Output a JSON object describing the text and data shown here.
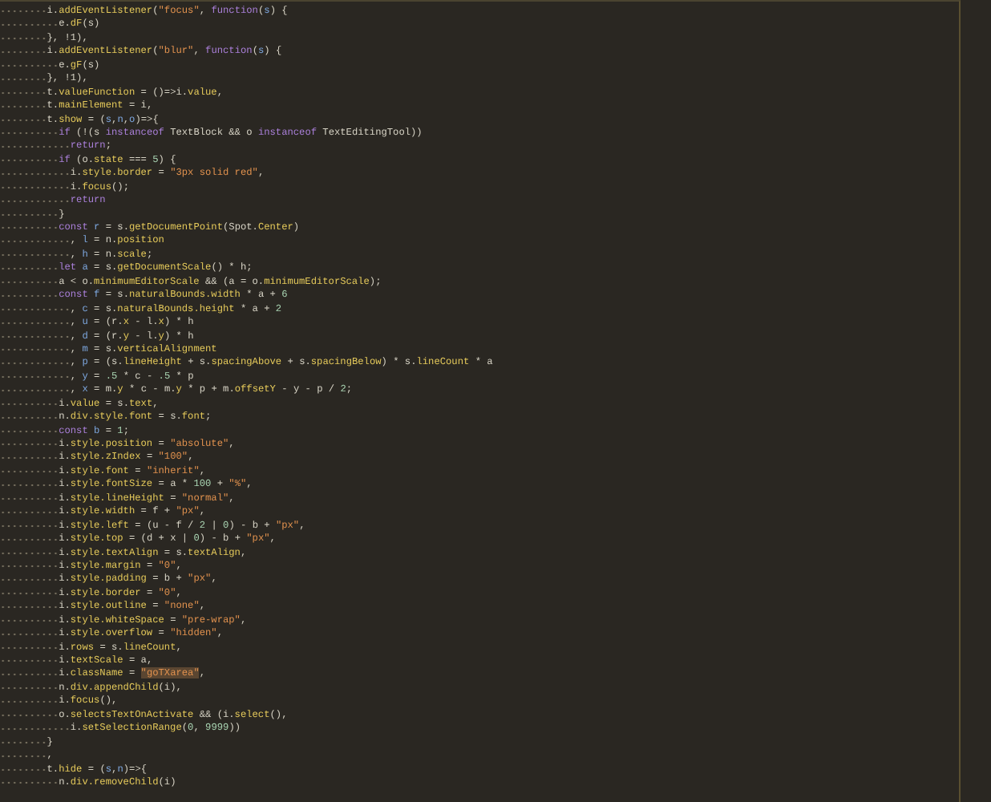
{
  "editor": {
    "lines": [
      {
        "tokens": [
          {
            "kind": "p",
            "text": "i."
          },
          {
            "kind": "y",
            "text": "addEventListener"
          },
          {
            "kind": "p",
            "text": "("
          },
          {
            "kind": "s",
            "text": "\"focus\""
          },
          {
            "kind": "p",
            "text": ", "
          },
          {
            "kind": "k",
            "text": "function"
          },
          {
            "kind": "p",
            "text": "("
          },
          {
            "kind": "v",
            "text": "s"
          },
          {
            "kind": "p",
            "text": ") {"
          }
        ],
        "children": [
          {
            "tokens": [
              {
                "kind": "p",
                "text": "e."
              },
              {
                "kind": "y",
                "text": "dF"
              },
              {
                "kind": "p",
                "text": "(s)"
              }
            ]
          }
        ]
      },
      {
        "tokens": [
          {
            "kind": "p",
            "text": "}, !1),"
          }
        ]
      },
      {
        "tokens": [
          {
            "kind": "p",
            "text": "i."
          },
          {
            "kind": "y",
            "text": "addEventListener"
          },
          {
            "kind": "p",
            "text": "("
          },
          {
            "kind": "s",
            "text": "\"blur\""
          },
          {
            "kind": "p",
            "text": ", "
          },
          {
            "kind": "k",
            "text": "function"
          },
          {
            "kind": "p",
            "text": "("
          },
          {
            "kind": "v",
            "text": "s"
          },
          {
            "kind": "p",
            "text": ") {"
          }
        ],
        "children": [
          {
            "tokens": [
              {
                "kind": "p",
                "text": "e."
              },
              {
                "kind": "y",
                "text": "gF"
              },
              {
                "kind": "p",
                "text": "(s)"
              }
            ]
          }
        ]
      },
      {
        "tokens": [
          {
            "kind": "p",
            "text": "}, !1),"
          }
        ]
      },
      {
        "tokens": [
          {
            "kind": "p",
            "text": "t."
          },
          {
            "kind": "y",
            "text": "valueFunction"
          },
          {
            "kind": "p",
            "text": " = ()=>i."
          },
          {
            "kind": "y",
            "text": "value"
          },
          {
            "kind": "p",
            "text": ","
          }
        ]
      },
      {
        "tokens": [
          {
            "kind": "p",
            "text": "t."
          },
          {
            "kind": "y",
            "text": "mainElement"
          },
          {
            "kind": "p",
            "text": " = i,"
          }
        ]
      },
      {
        "tokens": [
          {
            "kind": "p",
            "text": "t."
          },
          {
            "kind": "y",
            "text": "show"
          },
          {
            "kind": "p",
            "text": " = ("
          },
          {
            "kind": "v",
            "text": "s"
          },
          {
            "kind": "p",
            "text": ","
          },
          {
            "kind": "v",
            "text": "n"
          },
          {
            "kind": "p",
            "text": ","
          },
          {
            "kind": "v",
            "text": "o"
          },
          {
            "kind": "p",
            "text": ")=>{"
          }
        ],
        "children": [
          {
            "tokens": [
              {
                "kind": "k",
                "text": "if"
              },
              {
                "kind": "p",
                "text": " (!(s "
              },
              {
                "kind": "k",
                "text": "instanceof"
              },
              {
                "kind": "p",
                "text": " TextBlock && o "
              },
              {
                "kind": "k",
                "text": "instanceof"
              },
              {
                "kind": "p",
                "text": " TextEditingTool))"
              }
            ],
            "children": [
              {
                "tokens": [
                  {
                    "kind": "k",
                    "text": "return"
                  },
                  {
                    "kind": "p",
                    "text": ";"
                  }
                ]
              }
            ]
          },
          {
            "tokens": [
              {
                "kind": "k",
                "text": "if"
              },
              {
                "kind": "p",
                "text": " (o."
              },
              {
                "kind": "y",
                "text": "state"
              },
              {
                "kind": "p",
                "text": " === "
              },
              {
                "kind": "n",
                "text": "5"
              },
              {
                "kind": "p",
                "text": ") {"
              }
            ],
            "children": [
              {
                "tokens": [
                  {
                    "kind": "p",
                    "text": "i."
                  },
                  {
                    "kind": "y",
                    "text": "style.border"
                  },
                  {
                    "kind": "p",
                    "text": " = "
                  },
                  {
                    "kind": "s",
                    "text": "\"3px solid red\""
                  },
                  {
                    "kind": "p",
                    "text": ","
                  }
                ]
              },
              {
                "tokens": [
                  {
                    "kind": "p",
                    "text": "i."
                  },
                  {
                    "kind": "y",
                    "text": "focus"
                  },
                  {
                    "kind": "p",
                    "text": "();"
                  }
                ]
              },
              {
                "tokens": [
                  {
                    "kind": "k",
                    "text": "return"
                  }
                ]
              }
            ]
          },
          {
            "tokens": [
              {
                "kind": "p",
                "text": "}"
              }
            ]
          },
          {
            "tokens": [
              {
                "kind": "k",
                "text": "const "
              },
              {
                "kind": "v",
                "text": "r"
              },
              {
                "kind": "p",
                "text": " = s."
              },
              {
                "kind": "y",
                "text": "getDocumentPoint"
              },
              {
                "kind": "p",
                "text": "(Spot."
              },
              {
                "kind": "y",
                "text": "Center"
              },
              {
                "kind": "p",
                "text": ")"
              }
            ],
            "children": [
              {
                "tokens": [
                  {
                    "kind": "p",
                    "text": ", "
                  },
                  {
                    "kind": "v",
                    "text": "l"
                  },
                  {
                    "kind": "p",
                    "text": " = n."
                  },
                  {
                    "kind": "y",
                    "text": "position"
                  }
                ]
              },
              {
                "tokens": [
                  {
                    "kind": "p",
                    "text": ", "
                  },
                  {
                    "kind": "v",
                    "text": "h"
                  },
                  {
                    "kind": "p",
                    "text": " = n."
                  },
                  {
                    "kind": "y",
                    "text": "scale"
                  },
                  {
                    "kind": "p",
                    "text": ";"
                  }
                ]
              }
            ]
          },
          {
            "tokens": [
              {
                "kind": "k",
                "text": "let "
              },
              {
                "kind": "v",
                "text": "a"
              },
              {
                "kind": "p",
                "text": " = s."
              },
              {
                "kind": "y",
                "text": "getDocumentScale"
              },
              {
                "kind": "p",
                "text": "() * h;"
              }
            ]
          },
          {
            "tokens": [
              {
                "kind": "p",
                "text": "a < o."
              },
              {
                "kind": "y",
                "text": "minimumEditorScale"
              },
              {
                "kind": "p",
                "text": " && (a = o."
              },
              {
                "kind": "y",
                "text": "minimumEditorScale"
              },
              {
                "kind": "p",
                "text": ");"
              }
            ]
          },
          {
            "tokens": [
              {
                "kind": "k",
                "text": "const "
              },
              {
                "kind": "v",
                "text": "f"
              },
              {
                "kind": "p",
                "text": " = s."
              },
              {
                "kind": "y",
                "text": "naturalBounds.width"
              },
              {
                "kind": "p",
                "text": " * a + "
              },
              {
                "kind": "n",
                "text": "6"
              }
            ],
            "children": [
              {
                "tokens": [
                  {
                    "kind": "p",
                    "text": ", "
                  },
                  {
                    "kind": "v",
                    "text": "c"
                  },
                  {
                    "kind": "p",
                    "text": " = s."
                  },
                  {
                    "kind": "y",
                    "text": "naturalBounds.height"
                  },
                  {
                    "kind": "p",
                    "text": " * a + "
                  },
                  {
                    "kind": "n",
                    "text": "2"
                  }
                ]
              },
              {
                "tokens": [
                  {
                    "kind": "p",
                    "text": ", "
                  },
                  {
                    "kind": "v",
                    "text": "u"
                  },
                  {
                    "kind": "p",
                    "text": " = (r."
                  },
                  {
                    "kind": "y",
                    "text": "x"
                  },
                  {
                    "kind": "p",
                    "text": " - l."
                  },
                  {
                    "kind": "y",
                    "text": "x"
                  },
                  {
                    "kind": "p",
                    "text": ") * h"
                  }
                ]
              },
              {
                "tokens": [
                  {
                    "kind": "p",
                    "text": ", "
                  },
                  {
                    "kind": "v",
                    "text": "d"
                  },
                  {
                    "kind": "p",
                    "text": " = (r."
                  },
                  {
                    "kind": "y",
                    "text": "y"
                  },
                  {
                    "kind": "p",
                    "text": " - l."
                  },
                  {
                    "kind": "y",
                    "text": "y"
                  },
                  {
                    "kind": "p",
                    "text": ") * h"
                  }
                ]
              },
              {
                "tokens": [
                  {
                    "kind": "p",
                    "text": ", "
                  },
                  {
                    "kind": "v",
                    "text": "m"
                  },
                  {
                    "kind": "p",
                    "text": " = s."
                  },
                  {
                    "kind": "y",
                    "text": "verticalAlignment"
                  }
                ]
              },
              {
                "tokens": [
                  {
                    "kind": "p",
                    "text": ", "
                  },
                  {
                    "kind": "v",
                    "text": "p"
                  },
                  {
                    "kind": "p",
                    "text": " = (s."
                  },
                  {
                    "kind": "y",
                    "text": "lineHeight"
                  },
                  {
                    "kind": "p",
                    "text": " + s."
                  },
                  {
                    "kind": "y",
                    "text": "spacingAbove"
                  },
                  {
                    "kind": "p",
                    "text": " + s."
                  },
                  {
                    "kind": "y",
                    "text": "spacingBelow"
                  },
                  {
                    "kind": "p",
                    "text": ") * s."
                  },
                  {
                    "kind": "y",
                    "text": "lineCount"
                  },
                  {
                    "kind": "p",
                    "text": " * a"
                  }
                ]
              },
              {
                "tokens": [
                  {
                    "kind": "p",
                    "text": ", "
                  },
                  {
                    "kind": "v",
                    "text": "y"
                  },
                  {
                    "kind": "p",
                    "text": " = "
                  },
                  {
                    "kind": "n",
                    "text": ".5"
                  },
                  {
                    "kind": "p",
                    "text": " * c - "
                  },
                  {
                    "kind": "n",
                    "text": ".5"
                  },
                  {
                    "kind": "p",
                    "text": " * p"
                  }
                ]
              },
              {
                "tokens": [
                  {
                    "kind": "p",
                    "text": ", "
                  },
                  {
                    "kind": "v",
                    "text": "x"
                  },
                  {
                    "kind": "p",
                    "text": " = m."
                  },
                  {
                    "kind": "y",
                    "text": "y"
                  },
                  {
                    "kind": "p",
                    "text": " * c - m."
                  },
                  {
                    "kind": "y",
                    "text": "y"
                  },
                  {
                    "kind": "p",
                    "text": " * p + m."
                  },
                  {
                    "kind": "y",
                    "text": "offsetY"
                  },
                  {
                    "kind": "p",
                    "text": " - y - p / "
                  },
                  {
                    "kind": "n",
                    "text": "2"
                  },
                  {
                    "kind": "p",
                    "text": ";"
                  }
                ]
              }
            ]
          },
          {
            "tokens": [
              {
                "kind": "p",
                "text": "i."
              },
              {
                "kind": "y",
                "text": "value"
              },
              {
                "kind": "p",
                "text": " = s."
              },
              {
                "kind": "y",
                "text": "text"
              },
              {
                "kind": "p",
                "text": ","
              }
            ]
          },
          {
            "tokens": [
              {
                "kind": "p",
                "text": "n."
              },
              {
                "kind": "y",
                "text": "div.style.font"
              },
              {
                "kind": "p",
                "text": " = s."
              },
              {
                "kind": "y",
                "text": "font"
              },
              {
                "kind": "p",
                "text": ";"
              }
            ]
          },
          {
            "tokens": [
              {
                "kind": "k",
                "text": "const "
              },
              {
                "kind": "v",
                "text": "b"
              },
              {
                "kind": "p",
                "text": " = "
              },
              {
                "kind": "n",
                "text": "1"
              },
              {
                "kind": "p",
                "text": ";"
              }
            ]
          },
          {
            "tokens": [
              {
                "kind": "p",
                "text": "i."
              },
              {
                "kind": "y",
                "text": "style.position"
              },
              {
                "kind": "p",
                "text": " = "
              },
              {
                "kind": "s",
                "text": "\"absolute\""
              },
              {
                "kind": "p",
                "text": ","
              }
            ]
          },
          {
            "tokens": [
              {
                "kind": "p",
                "text": "i."
              },
              {
                "kind": "y",
                "text": "style.zIndex"
              },
              {
                "kind": "p",
                "text": " = "
              },
              {
                "kind": "s",
                "text": "\"100\""
              },
              {
                "kind": "p",
                "text": ","
              }
            ]
          },
          {
            "tokens": [
              {
                "kind": "p",
                "text": "i."
              },
              {
                "kind": "y",
                "text": "style.font"
              },
              {
                "kind": "p",
                "text": " = "
              },
              {
                "kind": "s",
                "text": "\"inherit\""
              },
              {
                "kind": "p",
                "text": ","
              }
            ]
          },
          {
            "tokens": [
              {
                "kind": "p",
                "text": "i."
              },
              {
                "kind": "y",
                "text": "style.fontSize"
              },
              {
                "kind": "p",
                "text": " = a * "
              },
              {
                "kind": "n",
                "text": "100"
              },
              {
                "kind": "p",
                "text": " + "
              },
              {
                "kind": "s",
                "text": "\"%\""
              },
              {
                "kind": "p",
                "text": ","
              }
            ]
          },
          {
            "tokens": [
              {
                "kind": "p",
                "text": "i."
              },
              {
                "kind": "y",
                "text": "style.lineHeight"
              },
              {
                "kind": "p",
                "text": " = "
              },
              {
                "kind": "s",
                "text": "\"normal\""
              },
              {
                "kind": "p",
                "text": ","
              }
            ]
          },
          {
            "tokens": [
              {
                "kind": "p",
                "text": "i."
              },
              {
                "kind": "y",
                "text": "style.width"
              },
              {
                "kind": "p",
                "text": " = f + "
              },
              {
                "kind": "s",
                "text": "\"px\""
              },
              {
                "kind": "p",
                "text": ","
              }
            ]
          },
          {
            "tokens": [
              {
                "kind": "p",
                "text": "i."
              },
              {
                "kind": "y",
                "text": "style.left"
              },
              {
                "kind": "p",
                "text": " = (u - f / "
              },
              {
                "kind": "n",
                "text": "2"
              },
              {
                "kind": "p",
                "text": " | "
              },
              {
                "kind": "n",
                "text": "0"
              },
              {
                "kind": "p",
                "text": ") - b + "
              },
              {
                "kind": "s",
                "text": "\"px\""
              },
              {
                "kind": "p",
                "text": ","
              }
            ]
          },
          {
            "tokens": [
              {
                "kind": "p",
                "text": "i."
              },
              {
                "kind": "y",
                "text": "style.top"
              },
              {
                "kind": "p",
                "text": " = (d + x | "
              },
              {
                "kind": "n",
                "text": "0"
              },
              {
                "kind": "p",
                "text": ") - b + "
              },
              {
                "kind": "s",
                "text": "\"px\""
              },
              {
                "kind": "p",
                "text": ","
              }
            ]
          },
          {
            "tokens": [
              {
                "kind": "p",
                "text": "i."
              },
              {
                "kind": "y",
                "text": "style.textAlign"
              },
              {
                "kind": "p",
                "text": " = s."
              },
              {
                "kind": "y",
                "text": "textAlign"
              },
              {
                "kind": "p",
                "text": ","
              }
            ]
          },
          {
            "tokens": [
              {
                "kind": "p",
                "text": "i."
              },
              {
                "kind": "y",
                "text": "style.margin"
              },
              {
                "kind": "p",
                "text": " = "
              },
              {
                "kind": "s",
                "text": "\"0\""
              },
              {
                "kind": "p",
                "text": ","
              }
            ]
          },
          {
            "tokens": [
              {
                "kind": "p",
                "text": "i."
              },
              {
                "kind": "y",
                "text": "style.padding"
              },
              {
                "kind": "p",
                "text": " = b + "
              },
              {
                "kind": "s",
                "text": "\"px\""
              },
              {
                "kind": "p",
                "text": ","
              }
            ]
          },
          {
            "tokens": [
              {
                "kind": "p",
                "text": "i."
              },
              {
                "kind": "y",
                "text": "style.border"
              },
              {
                "kind": "p",
                "text": " = "
              },
              {
                "kind": "s",
                "text": "\"0\""
              },
              {
                "kind": "p",
                "text": ","
              }
            ]
          },
          {
            "tokens": [
              {
                "kind": "p",
                "text": "i."
              },
              {
                "kind": "y",
                "text": "style.outline"
              },
              {
                "kind": "p",
                "text": " = "
              },
              {
                "kind": "s",
                "text": "\"none\""
              },
              {
                "kind": "p",
                "text": ","
              }
            ]
          },
          {
            "tokens": [
              {
                "kind": "p",
                "text": "i."
              },
              {
                "kind": "y",
                "text": "style.whiteSpace"
              },
              {
                "kind": "p",
                "text": " = "
              },
              {
                "kind": "s",
                "text": "\"pre-wrap\""
              },
              {
                "kind": "p",
                "text": ","
              }
            ]
          },
          {
            "tokens": [
              {
                "kind": "p",
                "text": "i."
              },
              {
                "kind": "y",
                "text": "style.overflow"
              },
              {
                "kind": "p",
                "text": " = "
              },
              {
                "kind": "s",
                "text": "\"hidden\""
              },
              {
                "kind": "p",
                "text": ","
              }
            ]
          },
          {
            "tokens": [
              {
                "kind": "p",
                "text": "i."
              },
              {
                "kind": "y",
                "text": "rows"
              },
              {
                "kind": "p",
                "text": " = s."
              },
              {
                "kind": "y",
                "text": "lineCount"
              },
              {
                "kind": "p",
                "text": ","
              }
            ]
          },
          {
            "tokens": [
              {
                "kind": "p",
                "text": "i."
              },
              {
                "kind": "y",
                "text": "textScale"
              },
              {
                "kind": "p",
                "text": " = a,"
              }
            ]
          },
          {
            "tokens": [
              {
                "kind": "p",
                "text": "i."
              },
              {
                "kind": "y",
                "text": "className"
              },
              {
                "kind": "p",
                "text": " = "
              },
              {
                "kind": "h",
                "text": "\"goTXarea\""
              },
              {
                "kind": "p",
                "text": ","
              }
            ]
          },
          {
            "tokens": [
              {
                "kind": "p",
                "text": "n."
              },
              {
                "kind": "y",
                "text": "div.appendChild"
              },
              {
                "kind": "p",
                "text": "(i),"
              }
            ]
          },
          {
            "tokens": [
              {
                "kind": "p",
                "text": "i."
              },
              {
                "kind": "y",
                "text": "focus"
              },
              {
                "kind": "p",
                "text": "(),"
              }
            ]
          },
          {
            "tokens": [
              {
                "kind": "p",
                "text": "o."
              },
              {
                "kind": "y",
                "text": "selectsTextOnActivate"
              },
              {
                "kind": "p",
                "text": " && (i."
              },
              {
                "kind": "y",
                "text": "select"
              },
              {
                "kind": "p",
                "text": "(),"
              }
            ],
            "children": [
              {
                "tokens": [
                  {
                    "kind": "p",
                    "text": "i."
                  },
                  {
                    "kind": "y",
                    "text": "setSelectionRange"
                  },
                  {
                    "kind": "p",
                    "text": "("
                  },
                  {
                    "kind": "n",
                    "text": "0"
                  },
                  {
                    "kind": "p",
                    "text": ", "
                  },
                  {
                    "kind": "n",
                    "text": "9999"
                  },
                  {
                    "kind": "p",
                    "text": "))"
                  }
                ]
              }
            ]
          }
        ]
      },
      {
        "tokens": [
          {
            "kind": "p",
            "text": "}"
          }
        ]
      },
      {
        "tokens": [
          {
            "kind": "p",
            "text": ","
          }
        ]
      },
      {
        "tokens": [
          {
            "kind": "p",
            "text": "t."
          },
          {
            "kind": "y",
            "text": "hide"
          },
          {
            "kind": "p",
            "text": " = ("
          },
          {
            "kind": "v",
            "text": "s"
          },
          {
            "kind": "p",
            "text": ","
          },
          {
            "kind": "v",
            "text": "n"
          },
          {
            "kind": "p",
            "text": ")=>{"
          }
        ],
        "children": [
          {
            "tokens": [
              {
                "kind": "p",
                "text": "n."
              },
              {
                "kind": "y",
                "text": "div.removeChild"
              },
              {
                "kind": "p",
                "text": "(i)"
              }
            ]
          }
        ]
      }
    ]
  }
}
